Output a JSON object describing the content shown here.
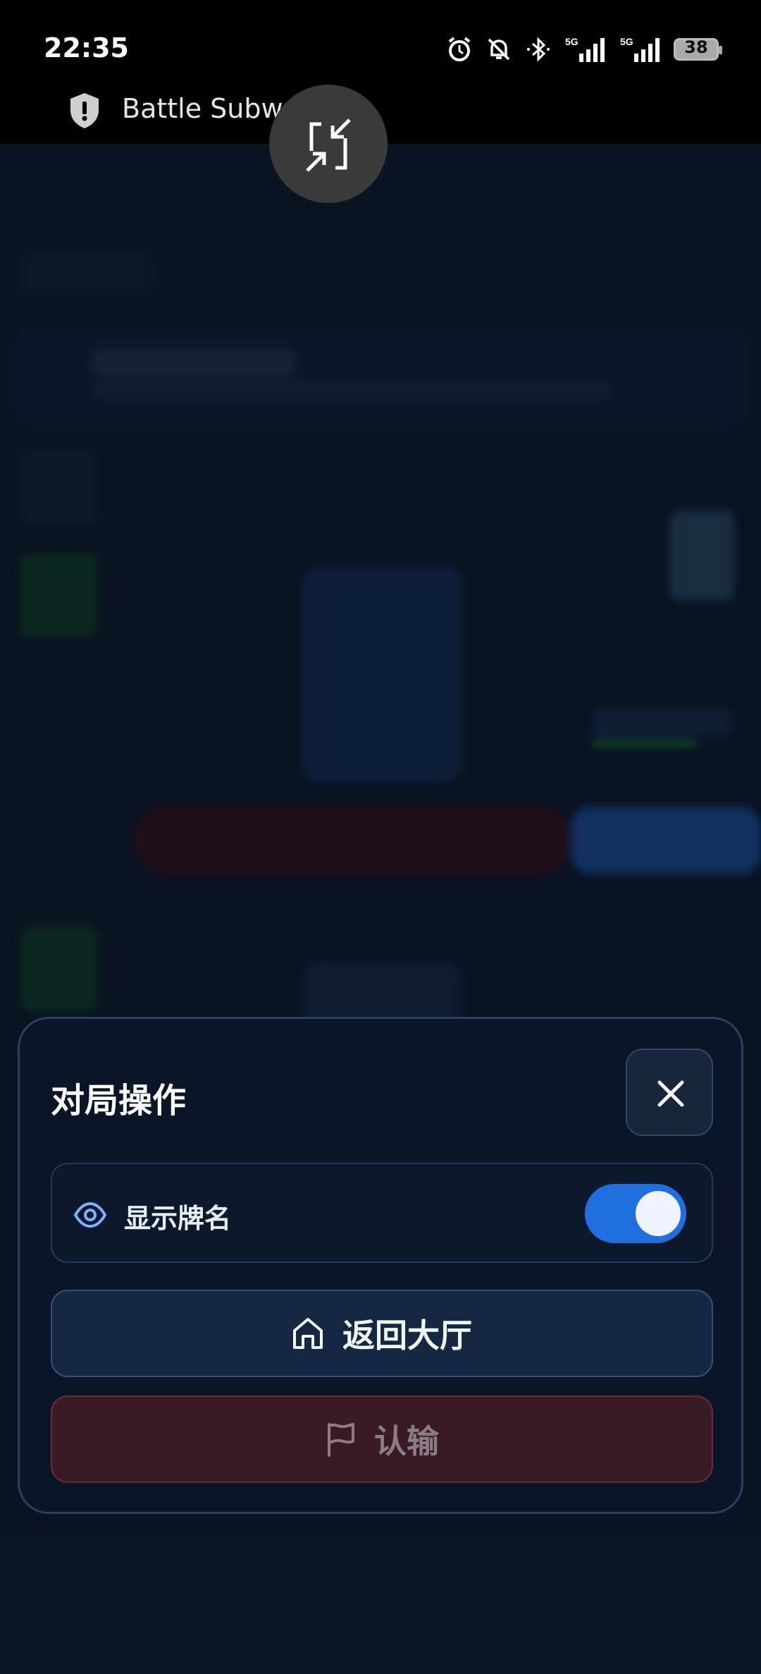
{
  "status_bar": {
    "time": "22:35",
    "battery_level": "38",
    "icons": [
      "alarm-icon",
      "mute-icon",
      "bluetooth-icon",
      "signal-5g-icon",
      "signal-5g-icon",
      "battery-icon"
    ]
  },
  "app_bar": {
    "title": "Battle Subwa",
    "icon": "shield-icon"
  },
  "floating_button": {
    "icon": "minimize-icon"
  },
  "modal": {
    "title": "对局操作",
    "close_icon": "close-icon",
    "show_card_names": {
      "label": "显示牌名",
      "icon": "eye-icon",
      "enabled": true
    },
    "return_lobby": {
      "label": "返回大厅",
      "icon": "home-icon"
    },
    "surrender": {
      "label": "认输",
      "icon": "flag-icon"
    }
  },
  "colors": {
    "accent": "#1f6fe0",
    "modal_bg": "#0a1628",
    "danger_bg": "#3a1a24",
    "background": "#0a1424"
  }
}
